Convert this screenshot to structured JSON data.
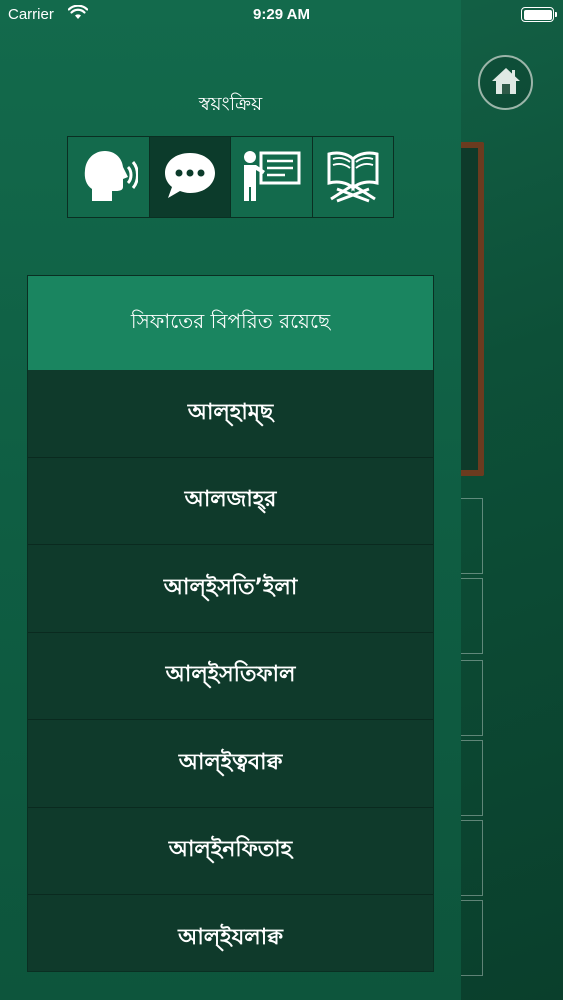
{
  "status_bar": {
    "carrier": "Carrier",
    "time": "9:29 AM",
    "wifi_icon": "wifi-icon",
    "battery_icon": "battery-icon"
  },
  "drawer": {
    "auto_label": "স্বয়ংক্রিয়",
    "modes": [
      {
        "icon": "speaking-head-icon",
        "selected": false
      },
      {
        "icon": "chat-bubble-icon",
        "selected": true
      },
      {
        "icon": "teacher-board-icon",
        "selected": false
      },
      {
        "icon": "quran-book-icon",
        "selected": false
      }
    ],
    "list": {
      "header": "সিফাতের বিপরিত রয়েছে",
      "items": [
        "আল্হাম্ছ",
        "আলজাহ্‌র",
        "আল্ইসতি’ইলা",
        "আল্ইসতিফাল",
        "আল্ইত্ববাক্ব",
        "আল্ইনফিতাহ",
        "আল্ইযলাক্ব"
      ]
    }
  },
  "background": {
    "home_icon": "home-icon"
  },
  "colors": {
    "drawer_bg": "#136a4c",
    "header_bg": "#1a8560",
    "item_bg": "#0f3a2b",
    "active_mode_bg": "#0c3b2b",
    "board_frame": "#6b3b1f"
  }
}
